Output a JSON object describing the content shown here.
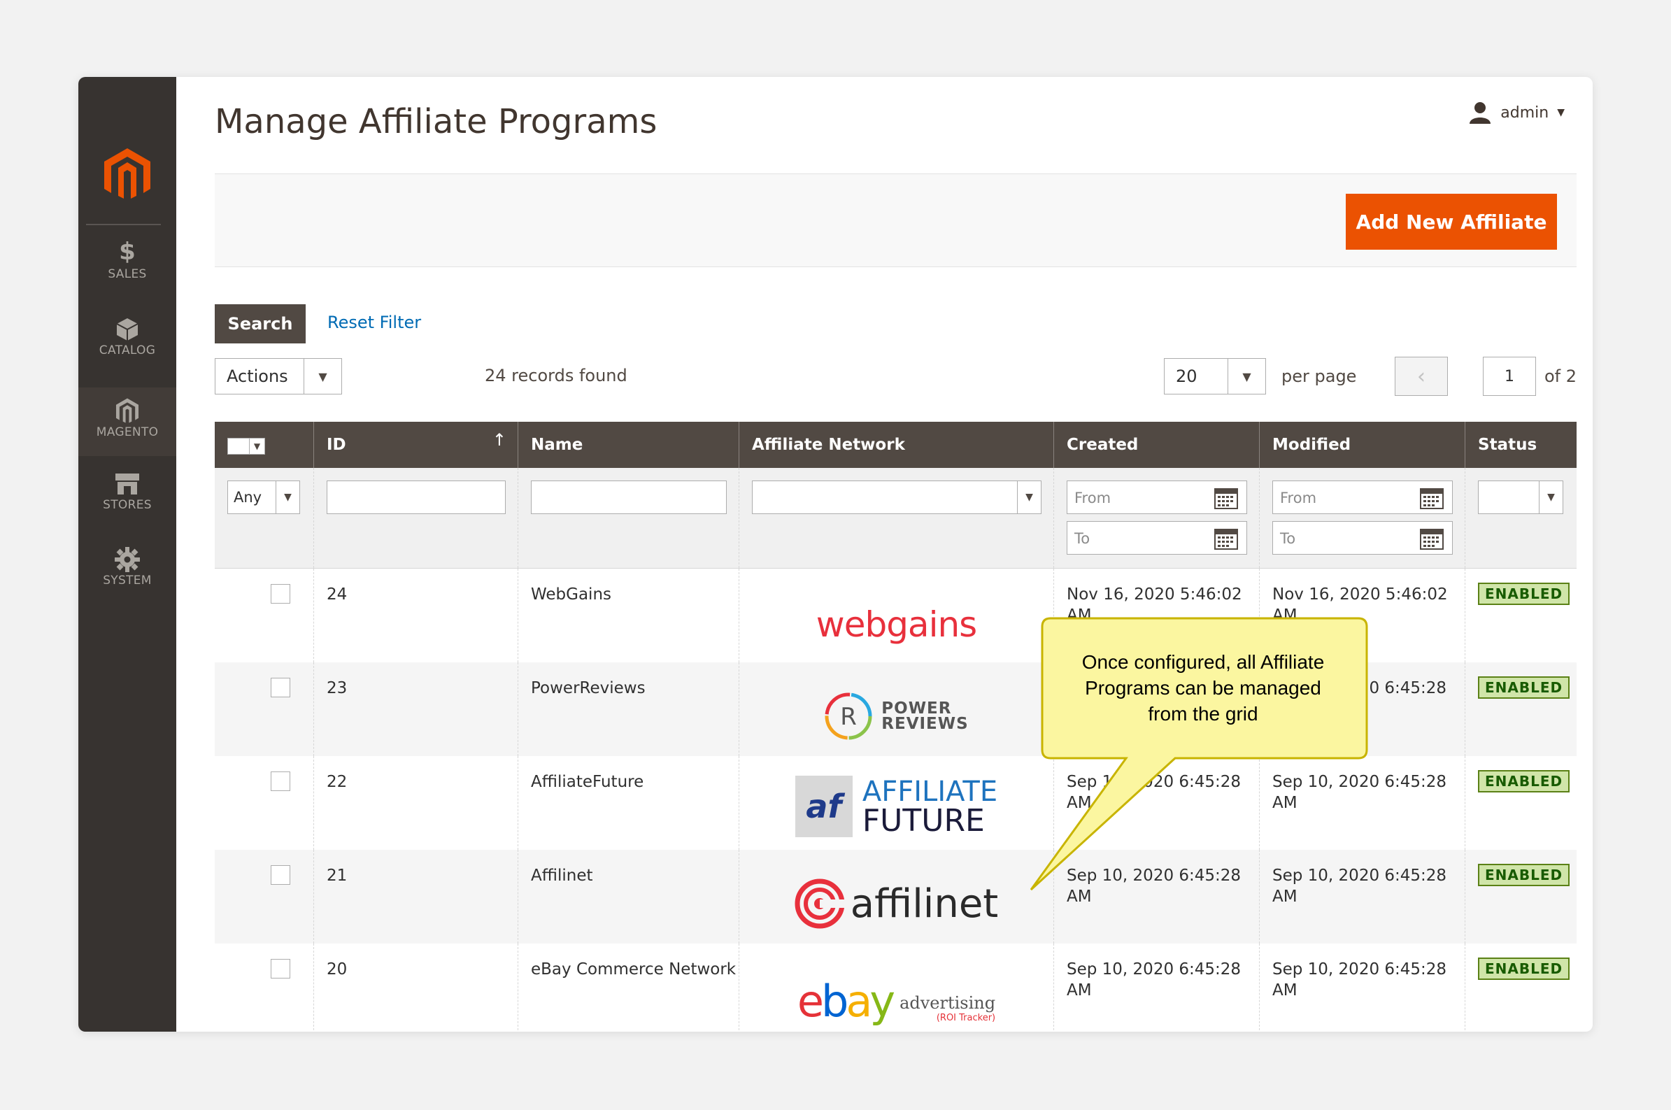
{
  "sidebar": {
    "items": [
      {
        "label": "SALES",
        "icon": "dollar-icon"
      },
      {
        "label": "CATALOG",
        "icon": "cube-icon"
      },
      {
        "label": "MAGENTO",
        "icon": "magento-icon"
      },
      {
        "label": "STORES",
        "icon": "store-icon"
      },
      {
        "label": "SYSTEM",
        "icon": "gear-icon"
      }
    ]
  },
  "header": {
    "title": "Manage Affiliate Programs",
    "user": "admin"
  },
  "toolbar": {
    "add_label": "Add New Affiliate",
    "search_label": "Search",
    "reset_label": "Reset Filter"
  },
  "grid_controls": {
    "actions_label": "Actions",
    "records": "24 records found",
    "per_page_value": "20",
    "per_page_label": "per page",
    "page": "1",
    "page_of": "of 2"
  },
  "columns": [
    "ID",
    "Name",
    "Affiliate Network",
    "Created",
    "Modified",
    "Status"
  ],
  "filters": {
    "any": "Any",
    "from": "From",
    "to": "To"
  },
  "rows": [
    {
      "id": "24",
      "name": "WebGains",
      "created": "Nov 16, 2020 5:46:02 AM",
      "modified": "Nov 16, 2020 5:46:02 AM",
      "status": "ENABLED",
      "logo_text": "webgains"
    },
    {
      "id": "23",
      "name": "PowerReviews",
      "created": "",
      "modified": "Sep 10, 2020 6:45:28 AM",
      "status": "ENABLED",
      "logo_text": "POWER REVIEWS"
    },
    {
      "id": "22",
      "name": "AffiliateFuture",
      "created": "Sep 10, 2020 6:45:28 AM",
      "modified": "Sep 10, 2020 6:45:28 AM",
      "status": "ENABLED",
      "logo_text": "AFFILIATE FUTURE"
    },
    {
      "id": "21",
      "name": "Affilinet",
      "created": "Sep 10, 2020 6:45:28 AM",
      "modified": "Sep 10, 2020 6:45:28 AM",
      "status": "ENABLED",
      "logo_text": "affilinet"
    },
    {
      "id": "20",
      "name": "eBay Commerce Network",
      "created": "Sep 10, 2020 6:45:28 AM",
      "modified": "Sep 10, 2020 6:45:28 AM",
      "status": "ENABLED",
      "logo_text": "ebay advertising (ROI Tracker)"
    }
  ],
  "logos": {
    "webgains": "webgains",
    "power_1": "POWER",
    "power_2": "REVIEWS",
    "power_r": "R",
    "af_1": "AFFILIATE",
    "af_2": "FUTURE",
    "af_mark": "af",
    "affilinet": "affilinet",
    "ebay": "ebay",
    "ebay_tm": "™",
    "ebay_adv": "advertising",
    "ebay_roi": "(ROI Tracker)"
  },
  "callout": {
    "line1": "Once configured, all Affiliate",
    "line2": "Programs can be managed",
    "line3": "from the grid"
  },
  "colors": {
    "accent": "#eb5202",
    "sidebar": "#373330",
    "header": "#514943",
    "link": "#006bb4",
    "enabled": "#d0e5a9"
  }
}
